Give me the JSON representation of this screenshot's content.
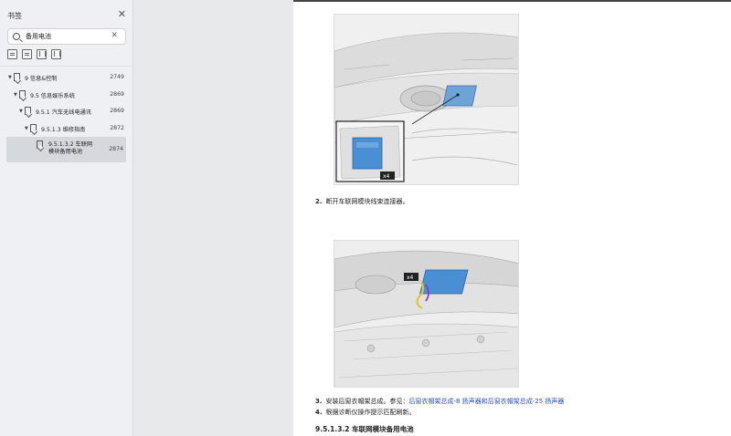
{
  "sidebar": {
    "title": "书签",
    "search_value": "备用电池",
    "tree": [
      {
        "label": "9 信息&控制",
        "page": "2749"
      },
      {
        "label": "9.5 信息娱乐系统",
        "page": "2869"
      },
      {
        "label": "9.5.1 汽车无线电通讯",
        "page": "2869"
      },
      {
        "label": "9.5.1.3 维修指南",
        "page": "2872"
      },
      {
        "label": "9.5.1.3.2 车联网模块备用电池",
        "page": "2874"
      }
    ]
  },
  "document": {
    "fig1_badge": "x4",
    "fig2_badge": "x4",
    "steps": [
      {
        "num": "2.",
        "text": "断开车联网模块线束连接器。"
      },
      {
        "num": "3.",
        "text": "安装后窗衣帽架总成。参见：",
        "link": "后窗衣帽架总成-8 扬声器和后窗衣帽架总成-25 扬声器"
      },
      {
        "num": "4.",
        "text": "根据诊断仪操作提示匹配刷新。"
      }
    ],
    "section_heading": "9.5.1.3.2 车联网模块备用电池"
  },
  "colors": {
    "link": "#2b50c8",
    "module": "#4a8fd4",
    "connector": "#d9c93a"
  }
}
